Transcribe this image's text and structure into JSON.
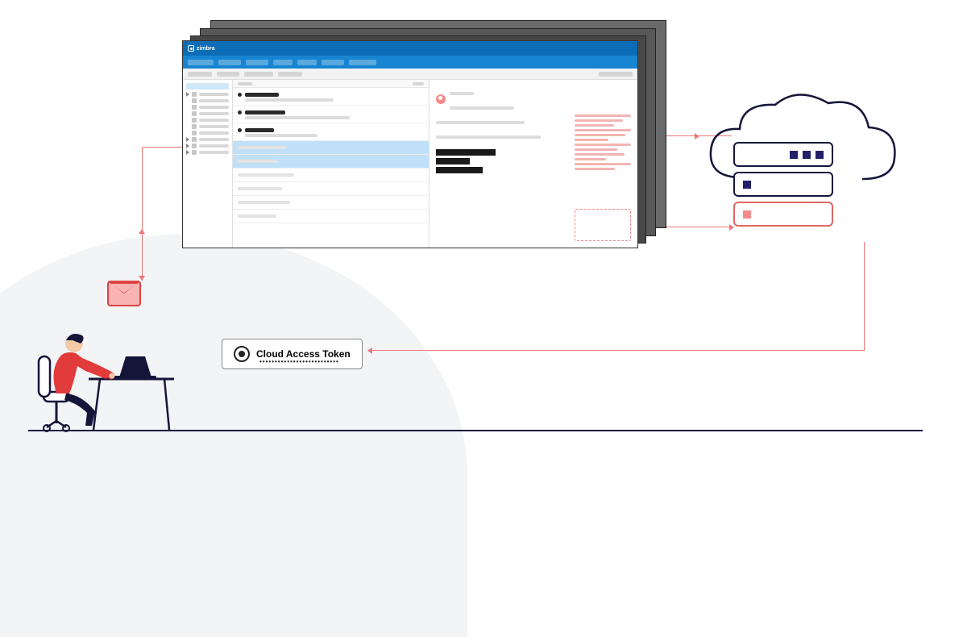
{
  "app": {
    "brand": "zimbra"
  },
  "token_label": "Cloud Access Token",
  "flow_nodes": [
    "user",
    "malicious-email",
    "zimbra-webmail",
    "cloud-server",
    "cloud-access-token"
  ],
  "colors": {
    "flow": "#e77",
    "brand_blue": "#0b6db7",
    "server_navy": "#23206a",
    "compromised": "#e06666"
  }
}
